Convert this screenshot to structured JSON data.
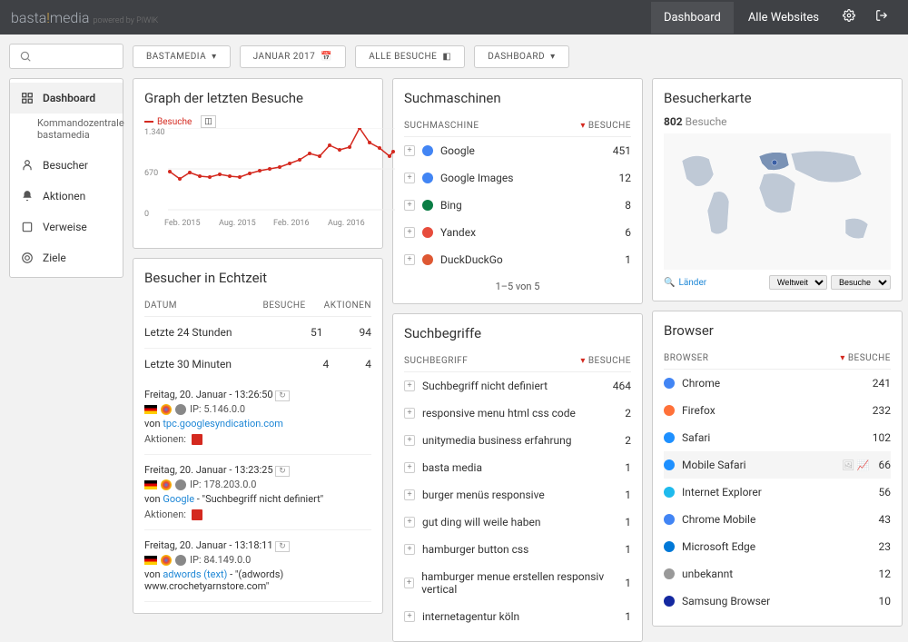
{
  "header": {
    "logo_main": "basta",
    "logo_dot": "!",
    "logo_rest": "media",
    "logo_sub": "powered by PIWIK",
    "nav_dashboard": "Dashboard",
    "nav_all_websites": "Alle Websites"
  },
  "toolbar": {
    "site": "BASTAMEDIA",
    "period": "JANUAR 2017",
    "segment": "ALLE BESUCHE",
    "dash": "DASHBOARD"
  },
  "sidebar": {
    "dashboard": "Dashboard",
    "sub": "Kommandozentrale bastamedia",
    "visitors": "Besucher",
    "actions": "Aktionen",
    "referrers": "Verweise",
    "goals": "Ziele"
  },
  "graph": {
    "title": "Graph der letzten Besuche",
    "legend": "Besuche",
    "y_max": "1.340",
    "y_mid": "670",
    "y_zero": "0",
    "x_labels": [
      "Feb. 2015",
      "Aug. 2015",
      "Feb. 2016",
      "Aug. 2016"
    ]
  },
  "realtime": {
    "title": "Besucher in Echtzeit",
    "h_date": "DATUM",
    "h_visits": "BESUCHE",
    "h_actions": "AKTIONEN",
    "rows": [
      {
        "label": "Letzte 24 Stunden",
        "visits": "51",
        "actions": "94"
      },
      {
        "label": "Letzte 30 Minuten",
        "visits": "4",
        "actions": "4"
      }
    ],
    "entries": [
      {
        "date": "Freitag, 20. Januar - 13:26:50",
        "ip": "IP: 5.146.0.0",
        "from_pre": "von ",
        "from_link": "tpc.googlesyndication.com",
        "from_post": "",
        "actions_label": "Aktionen:"
      },
      {
        "date": "Freitag, 20. Januar - 13:23:25",
        "ip": "IP: 178.203.0.0",
        "from_pre": "von ",
        "from_link": "Google",
        "from_post": " - \"Suchbegriff nicht definiert\"",
        "actions_label": "Aktionen:"
      },
      {
        "date": "Freitag, 20. Januar - 13:18:11",
        "ip": "IP: 84.149.0.0",
        "from_pre": "von ",
        "from_link": "adwords (text)",
        "from_post": " - \"(adwords) www.crochetyarnstore.com\""
      }
    ]
  },
  "search_engines": {
    "title": "Suchmaschinen",
    "h_engine": "SUCHMASCHINE",
    "h_visits": "BESUCHE",
    "rows": [
      {
        "name": "Google",
        "val": "451"
      },
      {
        "name": "Google Images",
        "val": "12"
      },
      {
        "name": "Bing",
        "val": "8"
      },
      {
        "name": "Yandex",
        "val": "6"
      },
      {
        "name": "DuckDuckGo",
        "val": "1"
      }
    ],
    "pagination": "1–5 von 5"
  },
  "keywords": {
    "title": "Suchbegriffe",
    "h_term": "SUCHBEGRIFF",
    "h_visits": "BESUCHE",
    "rows": [
      {
        "name": "Suchbegriff nicht definiert",
        "val": "464"
      },
      {
        "name": "responsive menu html css code",
        "val": "2"
      },
      {
        "name": "unitymedia business erfahrung",
        "val": "2"
      },
      {
        "name": "basta media",
        "val": "1"
      },
      {
        "name": "burger menüs responsive",
        "val": "1"
      },
      {
        "name": "gut ding will weile haben",
        "val": "1"
      },
      {
        "name": "hamburger button css",
        "val": "1"
      },
      {
        "name": "hamburger menue erstellen responsiv vertical",
        "val": "1"
      },
      {
        "name": "internetagentur köln",
        "val": "1"
      }
    ]
  },
  "map": {
    "title": "Besucherkarte",
    "count": "802",
    "count_label": "Besuche",
    "link": "Länder",
    "sel1": "Weltweit",
    "sel2": "Besuche"
  },
  "browser": {
    "title": "Browser",
    "h_browser": "BROWSER",
    "h_visits": "BESUCHE",
    "rows": [
      {
        "name": "Chrome",
        "val": "241"
      },
      {
        "name": "Firefox",
        "val": "232"
      },
      {
        "name": "Safari",
        "val": "102"
      },
      {
        "name": "Mobile Safari",
        "val": "66"
      },
      {
        "name": "Internet Explorer",
        "val": "56"
      },
      {
        "name": "Chrome Mobile",
        "val": "43"
      },
      {
        "name": "Microsoft Edge",
        "val": "23"
      },
      {
        "name": "unbekannt",
        "val": "12"
      },
      {
        "name": "Samsung Browser",
        "val": "10"
      }
    ]
  },
  "chart_data": {
    "type": "line",
    "title": "Graph der letzten Besuche",
    "ylabel": "Besuche",
    "ylim": [
      0,
      1340
    ],
    "x": [
      "Feb 2015",
      "Mar 2015",
      "Apr 2015",
      "May 2015",
      "Jun 2015",
      "Jul 2015",
      "Aug 2015",
      "Sep 2015",
      "Oct 2015",
      "Nov 2015",
      "Dec 2015",
      "Jan 2016",
      "Feb 2016",
      "Mar 2016",
      "Apr 2016",
      "May 2016",
      "Jun 2016",
      "Jul 2016",
      "Aug 2016",
      "Sep 2016",
      "Oct 2016",
      "Nov 2016",
      "Dec 2016",
      "Jan 2017"
    ],
    "series": [
      {
        "name": "Besuche",
        "values": [
          630,
          500,
          620,
          560,
          540,
          580,
          560,
          540,
          600,
          640,
          670,
          700,
          760,
          820,
          920,
          880,
          1060,
          980,
          1020,
          1340,
          1100,
          1020,
          880,
          960
        ]
      }
    ]
  }
}
